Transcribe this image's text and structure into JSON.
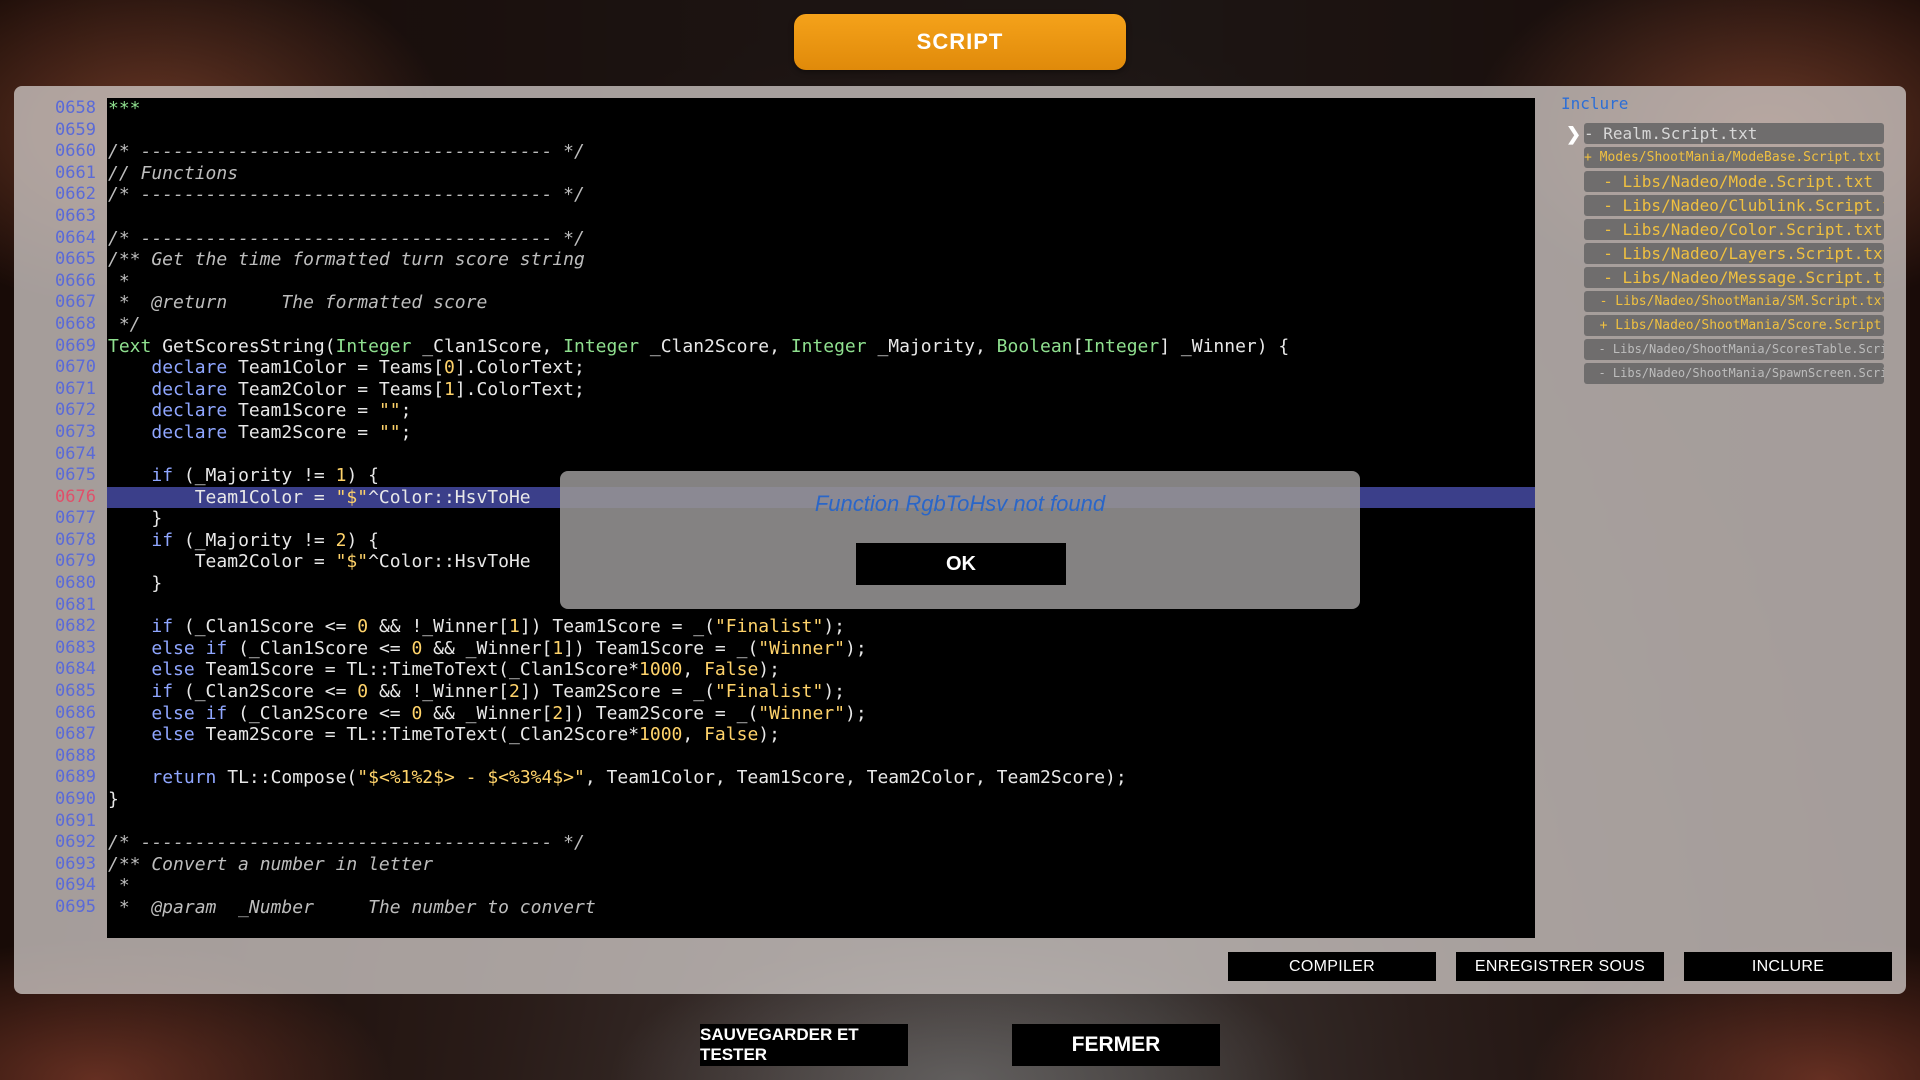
{
  "header": {
    "title": "SCRIPT"
  },
  "gutter": {
    "numbers": [
      "0658",
      "0659",
      "0660",
      "0661",
      "0662",
      "0663",
      "0664",
      "0665",
      "0666",
      "0667",
      "0668",
      "0669",
      "0670",
      "0671",
      "0672",
      "0673",
      "0674",
      "0675",
      "0676",
      "0677",
      "0678",
      "0679",
      "0680",
      "0681",
      "0682",
      "0683",
      "0684",
      "0685",
      "0686",
      "0687",
      "0688",
      "0689",
      "0690",
      "0691",
      "0692",
      "0693",
      "0694",
      "0695"
    ],
    "current_line": "0676"
  },
  "code": {
    "lines": [
      "***",
      "",
      "/* -------------------------------------- */",
      "// Functions",
      "/* -------------------------------------- */",
      "",
      "/* -------------------------------------- */",
      "/** Get the time formatted turn score string",
      " *",
      " *  @return     The formatted score",
      " */",
      "Text GetScoresString(Integer _Clan1Score, Integer _Clan2Score, Integer _Majority, Boolean[Integer] _Winner) {",
      "    declare Team1Color = Teams[0].ColorText;",
      "    declare Team2Color = Teams[1].ColorText;",
      "    declare Team1Score = \"\";",
      "    declare Team2Score = \"\";",
      "",
      "    if (_Majority != 1) {",
      "        Team1Color = \"$\"^Color::HsvToHe",
      "    }",
      "    if (_Majority != 2) {",
      "        Team2Color = \"$\"^Color::HsvToHe",
      "    }",
      "",
      "    if (_Clan1Score <= 0 && !_Winner[1]) Team1Score = _(\"Finalist\");",
      "    else if (_Clan1Score <= 0 && _Winner[1]) Team1Score = _(\"Winner\");",
      "    else Team1Score = TL::TimeToText(_Clan1Score*1000, False);",
      "    if (_Clan2Score <= 0 && !_Winner[2]) Team2Score = _(\"Finalist\");",
      "    else if (_Clan2Score <= 0 && _Winner[2]) Team2Score = _(\"Winner\");",
      "    else Team2Score = TL::TimeToText(_Clan2Score*1000, False);",
      "",
      "    return TL::Compose(\"$<%1%2$> - $<%3%4$>\", Team1Color, Team1Score, Team2Color, Team2Score);",
      "}",
      "",
      "/* -------------------------------------- */",
      "/** Convert a number in letter",
      " *",
      " *  @param  _Number     The number to convert"
    ]
  },
  "sidebar": {
    "title": "Inclure",
    "files": [
      {
        "label": "- Realm.Script.txt",
        "style": "grey",
        "size": 16
      },
      {
        "label": "+ Modes/ShootMania/ModeBase.Script.txt",
        "style": "yellow",
        "size": 13
      },
      {
        "label": "  - Libs/Nadeo/Mode.Script.txt",
        "style": "yellow",
        "size": 16
      },
      {
        "label": "  - Libs/Nadeo/Clublink.Script.txt",
        "style": "yellow",
        "size": 16
      },
      {
        "label": "  - Libs/Nadeo/Color.Script.txt",
        "style": "yellow",
        "size": 16
      },
      {
        "label": "  - Libs/Nadeo/Layers.Script.txt",
        "style": "yellow",
        "size": 16
      },
      {
        "label": "  - Libs/Nadeo/Message.Script.txt",
        "style": "yellow",
        "size": 16
      },
      {
        "label": "  - Libs/Nadeo/ShootMania/SM.Script.txt",
        "style": "yellow",
        "size": 13
      },
      {
        "label": "  + Libs/Nadeo/ShootMania/Score.Script.txt",
        "style": "yellow",
        "size": 13
      },
      {
        "label": "  - Libs/Nadeo/ShootMania/ScoresTable.Script.txt",
        "style": "dim",
        "size": 12
      },
      {
        "label": "  - Libs/Nadeo/ShootMania/SpawnScreen.Script.txt",
        "style": "dim",
        "size": 12
      }
    ]
  },
  "actions": {
    "compile": "COMPILER",
    "save_as": "ENREGISTRER SOUS",
    "include": "INCLURE"
  },
  "dialog": {
    "message": "Function RgbToHsv not found",
    "ok": "OK"
  },
  "footer": {
    "save_test": "SAUVEGARDER ET TESTER",
    "close": "FERMER"
  }
}
